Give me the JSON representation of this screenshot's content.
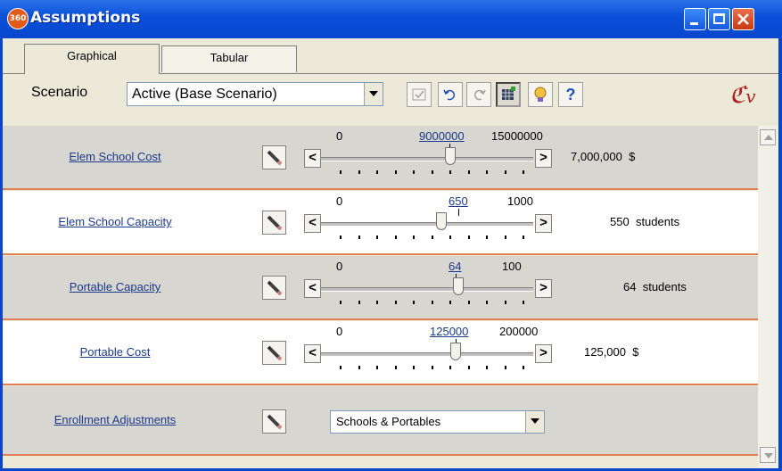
{
  "window": {
    "title": "Assumptions",
    "app_icon_text": "360"
  },
  "tabs": [
    {
      "label": "Graphical",
      "active": true
    },
    {
      "label": "Tabular",
      "active": false
    }
  ],
  "toolbar": {
    "scenario_label": "Scenario",
    "scenario_value": "Active (Base Scenario)",
    "buttons": [
      "save-scenario-icon",
      "undo-icon",
      "redo-icon",
      "grid-icon",
      "lightbulb-icon",
      "help-icon"
    ],
    "logo_text": "CV"
  },
  "rows": [
    {
      "label": "Elem School Cost",
      "min": "0",
      "current": "9000000",
      "max": "15000000",
      "value": "7,000,000",
      "unit": "$",
      "fraction": 0.6
    },
    {
      "label": "Elem School Capacity",
      "min": "0",
      "current": "650",
      "max": "1000",
      "value": "550",
      "unit": "students",
      "fraction": 0.55
    },
    {
      "label": "Portable Capacity",
      "min": "0",
      "current": "64",
      "max": "100",
      "value": "64",
      "unit": "students",
      "fraction": 0.64
    },
    {
      "label": "Portable Cost",
      "min": "0",
      "current": "125000",
      "max": "200000",
      "value": "125,000",
      "unit": "$",
      "fraction": 0.625
    },
    {
      "label": "Enrollment Adjustments",
      "dropdown": "Schools & Portables"
    }
  ],
  "colors": {
    "titlebar": "#0a4fd8",
    "row_separator": "#e08050",
    "link": "#1c3a8c"
  }
}
